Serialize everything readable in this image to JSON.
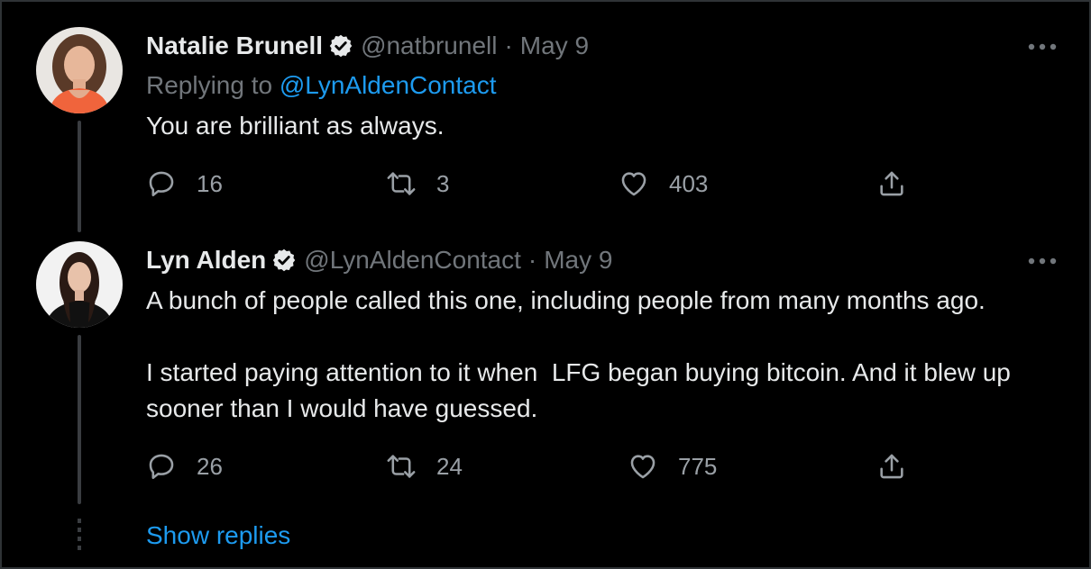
{
  "tweets": [
    {
      "name": "Natalie Brunell",
      "handle": "@natbrunell",
      "separator": "·",
      "date": "May 9",
      "replying_prefix": "Replying to ",
      "replying_to": "@LynAldenContact",
      "text": "You are brilliant as always.",
      "reply_count": "16",
      "retweet_count": "3",
      "like_count": "403"
    },
    {
      "name": "Lyn Alden",
      "handle": "@LynAldenContact",
      "separator": "·",
      "date": "May 9",
      "text": "A bunch of people called this one, including people from many months ago.\n\nI started paying attention to it when  LFG began buying bitcoin. And it blew up sooner than I would have guessed.",
      "reply_count": "26",
      "retweet_count": "24",
      "like_count": "775"
    }
  ],
  "show_replies_label": "Show replies",
  "icons": {
    "verified": "verified-badge-icon",
    "more": "more-options-icon",
    "reply": "reply-icon",
    "retweet": "retweet-icon",
    "like": "heart-icon",
    "share": "share-icon"
  },
  "colors": {
    "background": "#000000",
    "text": "#e7e9ea",
    "muted": "#71767b",
    "accent": "#1d9bf0",
    "thread_line": "#3a3d41"
  }
}
